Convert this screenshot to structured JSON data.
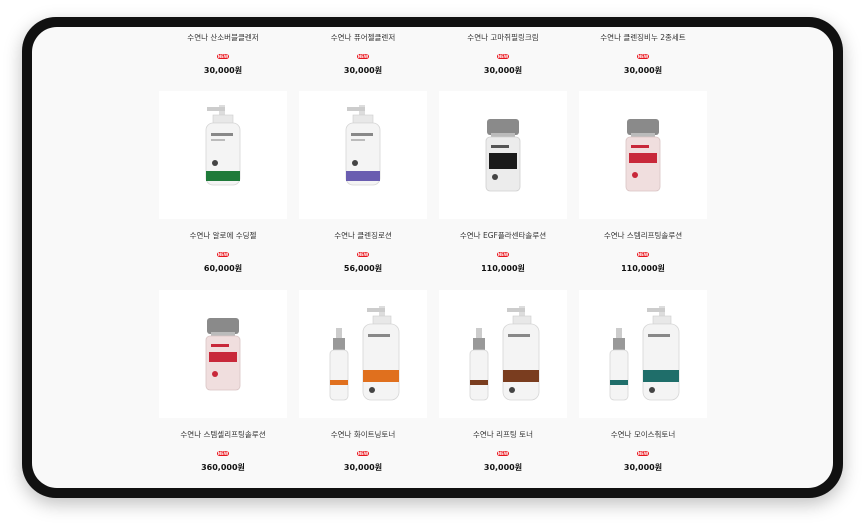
{
  "products": {
    "row0": [
      {
        "name": "수연나 산소버블클렌저",
        "badge": "NEW",
        "price": "30,000원"
      },
      {
        "name": "수연나 퓨어젤클렌저",
        "badge": "NEW",
        "price": "30,000원"
      },
      {
        "name": "수연나 고마쥐필링크림",
        "badge": "NEW",
        "price": "30,000원"
      },
      {
        "name": "수연나 클렌징비누 2종세트",
        "badge": "NEW",
        "price": "30,000원"
      }
    ],
    "row1": [
      {
        "name": "수연나 알로에 수딩젤",
        "badge": "NEW",
        "price": "60,000원",
        "label_color": "#1f7a3a",
        "label_text": "SOOTHING GEL",
        "icon": "pump-bottle-icon"
      },
      {
        "name": "수연나 클렌징로션",
        "badge": "NEW",
        "price": "56,000원",
        "label_color": "#6a5db0",
        "label_text": "CLEANSING LOTION",
        "icon": "pump-bottle-icon"
      },
      {
        "name": "수연나 EGF플라센타솔루션",
        "badge": "NEW",
        "price": "110,000원",
        "label_color": "#1a1a1a",
        "label_text": "EGF PLACENTA SOLUTION",
        "icon": "vial-icon"
      },
      {
        "name": "수연나 스템리프팅솔루션",
        "badge": "NEW",
        "price": "110,000원",
        "label_color": "#c8283a",
        "label_text": "STEMCELL LIFTING SOLUTION",
        "icon": "vial-icon"
      }
    ],
    "row2": [
      {
        "name": "수연나 스템셀리프팅솔루션",
        "badge": "NEW",
        "price": "360,000원",
        "label_color": "#c8283a",
        "label_text": "STEMCELL LIFTING SOLUTION",
        "icon": "vial-icon"
      },
      {
        "name": "수연나 화이트닝토너",
        "badge": "NEW",
        "price": "30,000원",
        "label_color": "#e0701e",
        "icon": "toner-set-icon"
      },
      {
        "name": "수연나 리프팅 토너",
        "badge": "NEW",
        "price": "30,000원",
        "label_color": "#7a3d1f",
        "icon": "toner-set-icon"
      },
      {
        "name": "수연나 모이스춰토너",
        "badge": "NEW",
        "price": "30,000원",
        "label_color": "#1f6e6a",
        "icon": "toner-set-icon"
      }
    ]
  },
  "brand": "Sooyeonna"
}
